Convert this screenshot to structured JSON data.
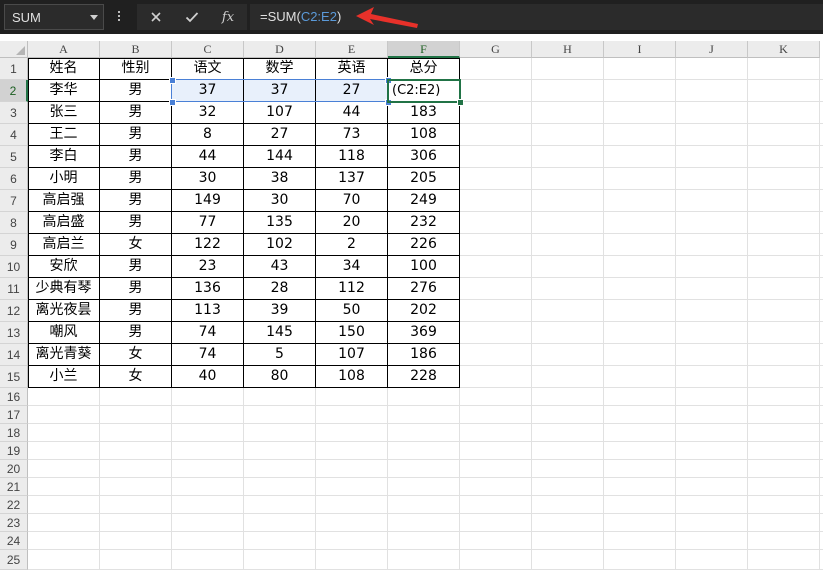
{
  "name_box": {
    "value": "SUM"
  },
  "formula_bar": {
    "prefix": "=SUM(",
    "reference": "C2:E2",
    "suffix": ")",
    "buttons": [
      "cancel-icon",
      "enter-icon",
      "fx-icon"
    ],
    "fx_label": "fx"
  },
  "annotation": {
    "color": "#e8312a"
  },
  "columns": [
    "A",
    "B",
    "C",
    "D",
    "E",
    "F",
    "G",
    "H",
    "I",
    "J",
    "K"
  ],
  "active_column": "F",
  "active_row": 2,
  "rows": [
    1,
    2,
    3,
    4,
    5,
    6,
    7,
    8,
    9,
    10,
    11,
    12,
    13,
    14,
    15,
    16,
    17,
    18,
    19,
    20,
    21,
    22,
    23,
    24,
    25
  ],
  "table": {
    "headers": [
      "姓名",
      "性别",
      "语文",
      "数学",
      "英语",
      "总分"
    ],
    "rows": [
      [
        "李华",
        "男",
        "37",
        "37",
        "27",
        "(C2:E2)"
      ],
      [
        "张三",
        "男",
        "32",
        "107",
        "44",
        "183"
      ],
      [
        "王二",
        "男",
        "8",
        "27",
        "73",
        "108"
      ],
      [
        "李白",
        "男",
        "44",
        "144",
        "118",
        "306"
      ],
      [
        "小明",
        "男",
        "30",
        "38",
        "137",
        "205"
      ],
      [
        "高启强",
        "男",
        "149",
        "30",
        "70",
        "249"
      ],
      [
        "高启盛",
        "男",
        "77",
        "135",
        "20",
        "232"
      ],
      [
        "高启兰",
        "女",
        "122",
        "102",
        "2",
        "226"
      ],
      [
        "安欣",
        "男",
        "23",
        "43",
        "34",
        "100"
      ],
      [
        "少典有琴",
        "男",
        "136",
        "28",
        "112",
        "276"
      ],
      [
        "离光夜昙",
        "男",
        "113",
        "39",
        "50",
        "202"
      ],
      [
        "嘲风",
        "男",
        "74",
        "145",
        "150",
        "369"
      ],
      [
        "离光青葵",
        "女",
        "74",
        "5",
        "107",
        "186"
      ],
      [
        "小兰",
        "女",
        "40",
        "80",
        "108",
        "228"
      ]
    ]
  },
  "colors": {
    "selection_green": "#217346",
    "reference_blue": "#4a80d6",
    "formula_ref_text": "#5b9ad9"
  }
}
